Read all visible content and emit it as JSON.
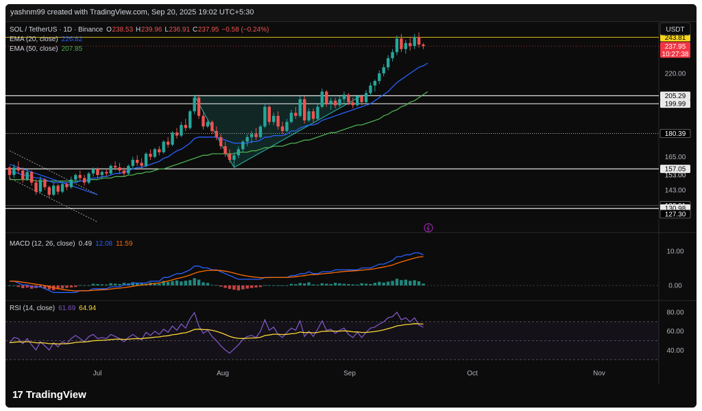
{
  "header": {
    "created": "yashnm99 created with TradingView.com, Sep 20, 2025 19:02 UTC+5:30"
  },
  "currency_button": "USDT",
  "legend": {
    "symbol": "SOL / TetherUS · 1D · Binance",
    "o_label": "O",
    "o": "238.53",
    "h_label": "H",
    "h": "239.96",
    "l_label": "L",
    "l": "236.91",
    "c_label": "C",
    "c": "237.95",
    "change": "−0.58 (−0.24%)",
    "ema20_label": "EMA (20, close)",
    "ema20": "226.82",
    "ema50_label": "EMA (50, close)",
    "ema50": "207.85"
  },
  "macd_legend": {
    "label": "MACD (12, 26, close)",
    "hist": "0.49",
    "macd": "12.08",
    "signal": "11.59"
  },
  "rsi_legend": {
    "label": "RSI (14, close)",
    "rsi": "61.69",
    "ma": "64.94"
  },
  "brand": "TradingView",
  "colors": {
    "up": "#26a69a",
    "down": "#ef5350",
    "ema20": "#2962ff",
    "ema50": "#4caf50",
    "macd": "#2962ff",
    "signal": "#ff6d00",
    "rsi": "#7e57c2",
    "rsi_ma": "#fdd835",
    "pattern": "#26a69a",
    "last_price": "#f23645",
    "ref_yellow": "#f7d51d"
  },
  "chart_data": [
    {
      "type": "candlestick",
      "title": "SOL / TetherUS · 1D · Binance",
      "x_ticks": [
        "Jul",
        "Aug",
        "Sep",
        "Oct",
        "Nov"
      ],
      "ylim": [
        120,
        253
      ],
      "y_ticks": [
        220.0,
        165.0,
        143.0
      ],
      "price_labels": [
        {
          "value": "243.81",
          "style": "yellow"
        },
        {
          "value": "237.95",
          "style": "red"
        },
        {
          "value": "10:27:38",
          "style": "red"
        },
        {
          "value": "205.29",
          "style": "white"
        },
        {
          "value": "199.99",
          "style": "white"
        },
        {
          "value": "180.39",
          "style": "dark"
        },
        {
          "value": "157.05",
          "style": "white"
        },
        {
          "value": "153.00",
          "style": "plain"
        },
        {
          "value": "132.91",
          "style": "dark"
        },
        {
          "value": "130.98",
          "style": "white"
        },
        {
          "value": "127.30",
          "style": "dark"
        }
      ],
      "levels": [
        {
          "value": 243.81,
          "style": "yellow"
        },
        {
          "value": 205.29,
          "style": "white"
        },
        {
          "value": 199.99,
          "style": "white"
        },
        {
          "value": 180.39,
          "style": "dotted"
        },
        {
          "value": 157.05,
          "style": "white"
        },
        {
          "value": 132.91,
          "style": "dark"
        },
        {
          "value": 130.98,
          "style": "white"
        }
      ],
      "ohlc_approx": [
        [
          158,
          159,
          150,
          153
        ],
        [
          153,
          160,
          151,
          158
        ],
        [
          158,
          162,
          154,
          156
        ],
        [
          156,
          158,
          148,
          150
        ],
        [
          150,
          157,
          149,
          155
        ],
        [
          155,
          156,
          146,
          148
        ],
        [
          148,
          150,
          140,
          142
        ],
        [
          142,
          152,
          141,
          150
        ],
        [
          150,
          151,
          143,
          145
        ],
        [
          145,
          146,
          138,
          140
        ],
        [
          140,
          148,
          139,
          146
        ],
        [
          146,
          147,
          140,
          142
        ],
        [
          142,
          149,
          141,
          147
        ],
        [
          147,
          148,
          143,
          145
        ],
        [
          145,
          152,
          144,
          150
        ],
        [
          150,
          154,
          148,
          153
        ],
        [
          153,
          156,
          149,
          151
        ],
        [
          151,
          153,
          146,
          148
        ],
        [
          148,
          155,
          147,
          154
        ],
        [
          154,
          158,
          152,
          157
        ],
        [
          157,
          158,
          151,
          153
        ],
        [
          153,
          156,
          150,
          155
        ],
        [
          155,
          157,
          152,
          154
        ],
        [
          154,
          160,
          153,
          159
        ],
        [
          159,
          162,
          156,
          158
        ],
        [
          158,
          161,
          154,
          156
        ],
        [
          156,
          158,
          152,
          154
        ],
        [
          154,
          160,
          153,
          159
        ],
        [
          159,
          165,
          157,
          163
        ],
        [
          163,
          166,
          159,
          161
        ],
        [
          161,
          164,
          157,
          159
        ],
        [
          159,
          168,
          158,
          167
        ],
        [
          167,
          170,
          163,
          165
        ],
        [
          165,
          171,
          164,
          170
        ],
        [
          170,
          172,
          166,
          168
        ],
        [
          168,
          176,
          167,
          175
        ],
        [
          175,
          178,
          171,
          173
        ],
        [
          173,
          182,
          172,
          181
        ],
        [
          181,
          184,
          177,
          179
        ],
        [
          179,
          188,
          178,
          186
        ],
        [
          186,
          190,
          182,
          184
        ],
        [
          184,
          196,
          183,
          195
        ],
        [
          195,
          206,
          193,
          204
        ],
        [
          204,
          206,
          190,
          192
        ],
        [
          192,
          194,
          183,
          185
        ],
        [
          185,
          190,
          184,
          188
        ],
        [
          188,
          189,
          180,
          182
        ],
        [
          182,
          185,
          176,
          178
        ],
        [
          178,
          180,
          170,
          172
        ],
        [
          172,
          175,
          165,
          167
        ],
        [
          167,
          170,
          161,
          163
        ],
        [
          163,
          168,
          158,
          166
        ],
        [
          166,
          172,
          164,
          170
        ],
        [
          170,
          176,
          168,
          175
        ],
        [
          175,
          180,
          172,
          178
        ],
        [
          178,
          182,
          174,
          180
        ],
        [
          180,
          184,
          176,
          178
        ],
        [
          178,
          186,
          177,
          185
        ],
        [
          185,
          200,
          184,
          198
        ],
        [
          198,
          199,
          186,
          188
        ],
        [
          188,
          194,
          186,
          192
        ],
        [
          192,
          195,
          183,
          185
        ],
        [
          185,
          188,
          180,
          182
        ],
        [
          182,
          190,
          181,
          188
        ],
        [
          188,
          196,
          187,
          194
        ],
        [
          194,
          198,
          190,
          192
        ],
        [
          192,
          205,
          191,
          203
        ],
        [
          203,
          205,
          187,
          189
        ],
        [
          189,
          197,
          188,
          195
        ],
        [
          195,
          197,
          188,
          190
        ],
        [
          190,
          200,
          189,
          198
        ],
        [
          198,
          210,
          197,
          208
        ],
        [
          208,
          209,
          198,
          200
        ],
        [
          200,
          204,
          196,
          202
        ],
        [
          202,
          204,
          197,
          199
        ],
        [
          199,
          205,
          198,
          203
        ],
        [
          203,
          208,
          200,
          206
        ],
        [
          206,
          207,
          199,
          201
        ],
        [
          201,
          204,
          197,
          199
        ],
        [
          199,
          206,
          198,
          205
        ],
        [
          205,
          206,
          199,
          201
        ],
        [
          201,
          209,
          200,
          207
        ],
        [
          207,
          214,
          205,
          212
        ],
        [
          212,
          216,
          208,
          215
        ],
        [
          215,
          222,
          213,
          220
        ],
        [
          220,
          226,
          218,
          224
        ],
        [
          224,
          232,
          222,
          230
        ],
        [
          230,
          236,
          228,
          234
        ],
        [
          234,
          245,
          232,
          243
        ],
        [
          243,
          246,
          234,
          236
        ],
        [
          236,
          242,
          233,
          240
        ],
        [
          240,
          244,
          235,
          238
        ],
        [
          238,
          246,
          236,
          244
        ],
        [
          244,
          247,
          237,
          239
        ],
        [
          239,
          240,
          236,
          238
        ]
      ],
      "ema20": [
        155,
        155,
        154,
        153,
        153,
        152,
        151,
        151,
        150,
        149,
        148,
        148,
        148,
        148,
        148,
        148,
        149,
        149,
        150,
        151,
        151,
        152,
        152,
        153,
        154,
        154,
        155,
        156,
        157,
        158,
        158,
        159,
        160,
        161,
        162,
        164,
        165,
        167,
        169,
        170,
        172,
        174,
        177,
        178,
        178,
        178,
        178,
        178,
        177,
        176,
        175,
        174,
        174,
        174,
        174,
        175,
        175,
        176,
        178,
        178,
        179,
        179,
        179,
        180,
        182,
        182,
        184,
        185,
        186,
        186,
        187,
        189,
        190,
        191,
        192,
        193,
        194,
        195,
        196,
        197,
        198,
        199,
        200,
        202,
        204,
        206,
        208,
        211,
        214,
        216,
        218,
        220,
        222,
        224,
        225,
        226.8
      ],
      "ema50": [
        150,
        150,
        150,
        150,
        150,
        150,
        149,
        149,
        149,
        149,
        149,
        149,
        149,
        149,
        149,
        149,
        149,
        149,
        150,
        150,
        150,
        151,
        151,
        151,
        152,
        152,
        152,
        153,
        153,
        154,
        154,
        155,
        155,
        156,
        157,
        157,
        158,
        159,
        160,
        161,
        162,
        163,
        164,
        165,
        166,
        166,
        167,
        167,
        167,
        167,
        167,
        167,
        168,
        168,
        168,
        169,
        169,
        170,
        171,
        171,
        172,
        172,
        172,
        173,
        174,
        174,
        175,
        176,
        176,
        177,
        178,
        179,
        180,
        181,
        181,
        182,
        183,
        184,
        185,
        186,
        186,
        187,
        188,
        189,
        190,
        192,
        193,
        195,
        196,
        198,
        199,
        201,
        202,
        204,
        206,
        207.9
      ],
      "macd_ylim": [
        -3,
        14
      ],
      "macd_ticks": [
        10.0,
        0.0
      ],
      "rsi_ylim": [
        25,
        88
      ],
      "rsi_ticks": [
        80.0,
        60.0,
        40.0
      ]
    }
  ]
}
